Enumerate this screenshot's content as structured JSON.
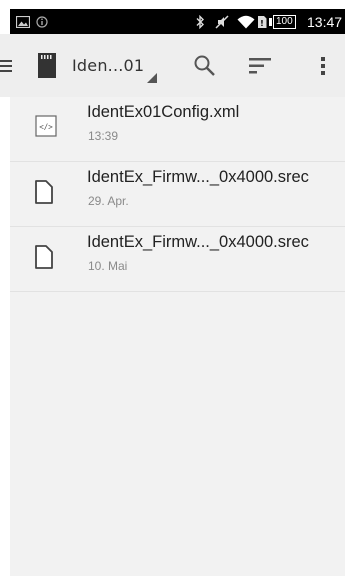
{
  "status_bar": {
    "time": "13:47",
    "battery_level": "100",
    "icons": [
      "image-icon",
      "info-icon",
      "bluetooth-icon",
      "mute-icon",
      "wifi-icon",
      "no-sim-icon",
      "battery-icon"
    ]
  },
  "toolbar": {
    "path_label": "Iden...01",
    "icons": [
      "menu-icon",
      "sdcard-icon",
      "search-icon",
      "sort-icon",
      "overflow-menu-icon"
    ]
  },
  "files": [
    {
      "name": "IdentEx01Config.xml",
      "meta": "13:39",
      "icon": "xml-file-icon"
    },
    {
      "name": "IdentEx_Firmw..._0x4000.srec",
      "meta": "29. Apr.",
      "icon": "file-icon"
    },
    {
      "name": "IdentEx_Firmw..._0x4000.srec",
      "meta": "10. Mai",
      "icon": "file-icon"
    }
  ],
  "colors": {
    "status_bar_bg": "#000000",
    "toolbar_bg": "#eeeeee",
    "list_bg": "#f2f2f2",
    "text_primary": "#222222",
    "text_secondary": "#8a8a8a"
  }
}
